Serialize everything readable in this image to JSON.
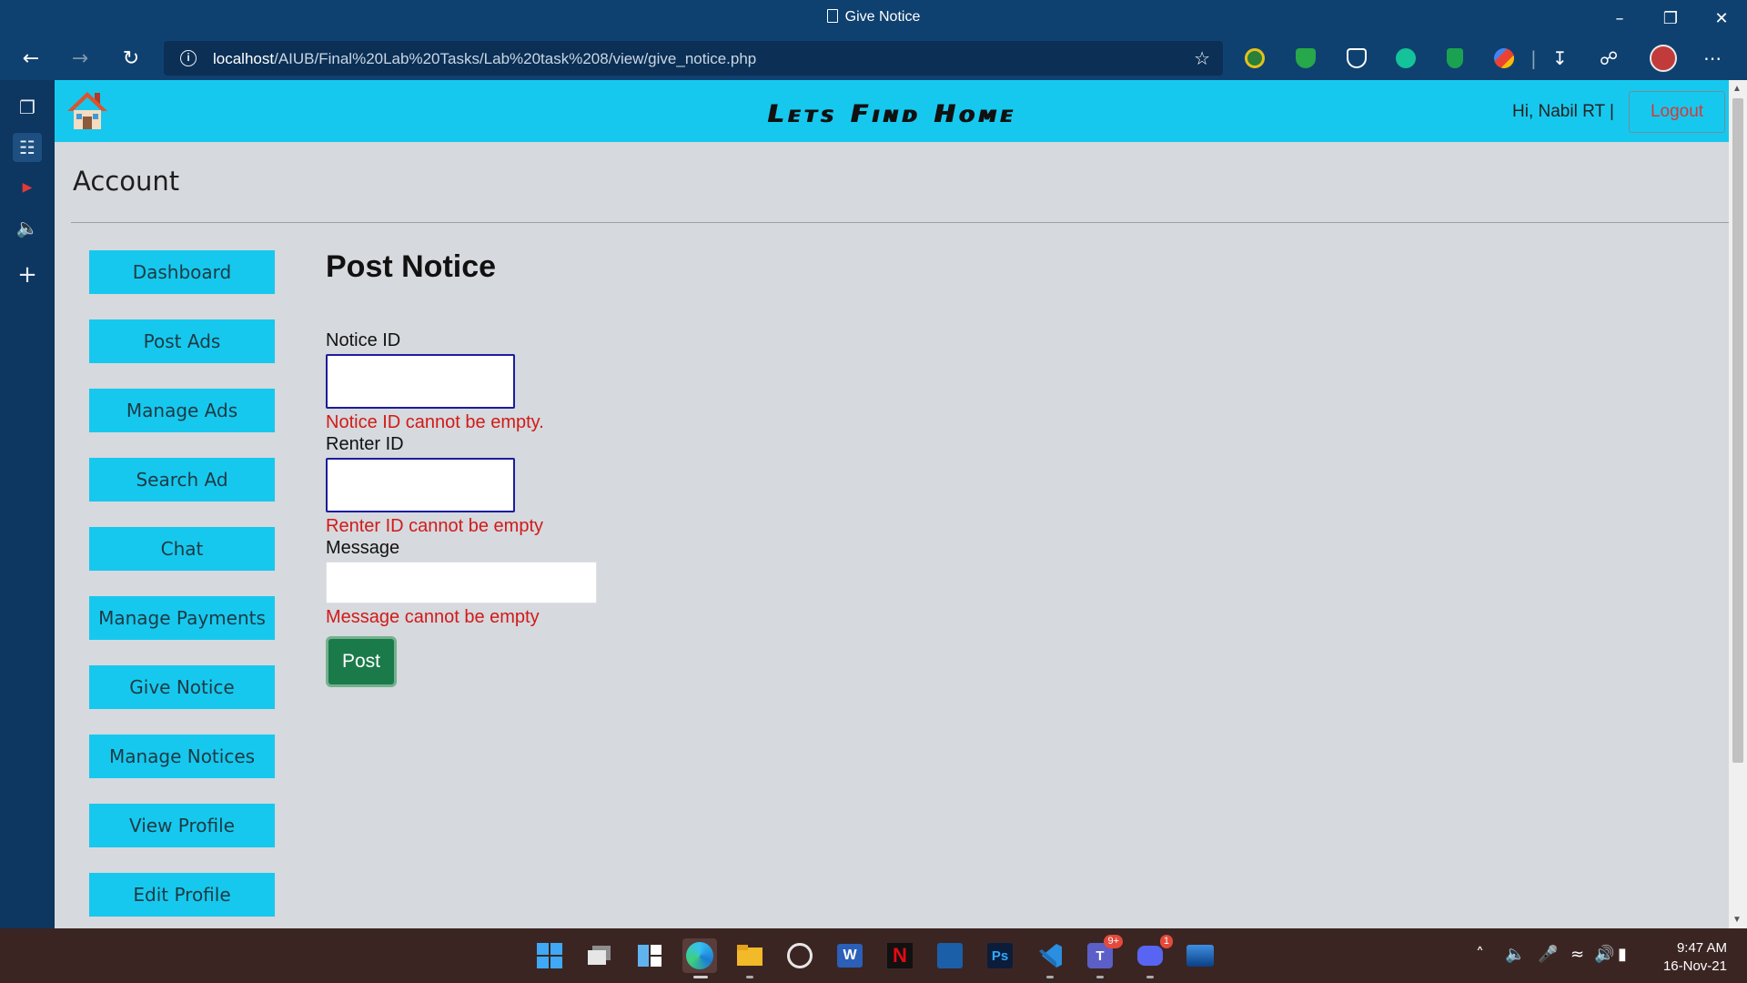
{
  "window": {
    "title": "Give Notice",
    "controls": [
      "minimize",
      "restore",
      "close"
    ]
  },
  "browser": {
    "url_host": "localhost",
    "url_path": "/AIUB/Final%20Lab%20Tasks/Lab%20task%208/view/give_notice.php",
    "nav_icons": [
      "back-icon",
      "forward-icon",
      "refresh-icon"
    ],
    "extensions": [
      "ext-eye-icon",
      "shield-green-icon",
      "brave-shield-icon",
      "grammarly-icon",
      "shield-check-icon",
      "dots-color-icon"
    ],
    "side_icons": [
      "tab-actions-icon",
      "collections-icon",
      "youtube-icon",
      "speaker-icon",
      "add-icon"
    ]
  },
  "site": {
    "title": "Lets Find Home",
    "greeting": "Hi, Nabil RT  |",
    "logout_label": "Logout",
    "accent_color": "#17c8ee"
  },
  "account": {
    "title": "Account"
  },
  "sidebar": {
    "items": [
      {
        "label": "Dashboard"
      },
      {
        "label": "Post Ads"
      },
      {
        "label": "Manage Ads"
      },
      {
        "label": "Search Ad"
      },
      {
        "label": "Chat"
      },
      {
        "label": "Manage Payments"
      },
      {
        "label": "Give Notice"
      },
      {
        "label": "Manage Notices"
      },
      {
        "label": "View Profile"
      },
      {
        "label": "Edit Profile"
      }
    ]
  },
  "form": {
    "heading": "Post Notice",
    "notice_id": {
      "label": "Notice ID",
      "value": "",
      "error": "Notice ID cannot be empty."
    },
    "renter_id": {
      "label": "Renter ID",
      "value": "",
      "error": "Renter ID cannot be empty"
    },
    "message": {
      "label": "Message",
      "value": "",
      "error": "Message cannot be empty"
    },
    "submit_label": "Post",
    "error_color": "#d11a1a",
    "submit_color": "#1b7a4a"
  },
  "taskbar": {
    "apps": [
      "windows-start-icon",
      "task-view-icon",
      "widgets-icon",
      "edge-icon",
      "file-explorer-icon",
      "obs-icon",
      "word-icon",
      "netflix-icon",
      "prime-video-icon",
      "photoshop-icon",
      "vscode-icon",
      "teams-icon",
      "discord-icon",
      "app-wave-icon"
    ],
    "teams_badge": "9+",
    "discord_badge": "1",
    "time": "9:47 AM",
    "date": "16-Nov-21"
  }
}
